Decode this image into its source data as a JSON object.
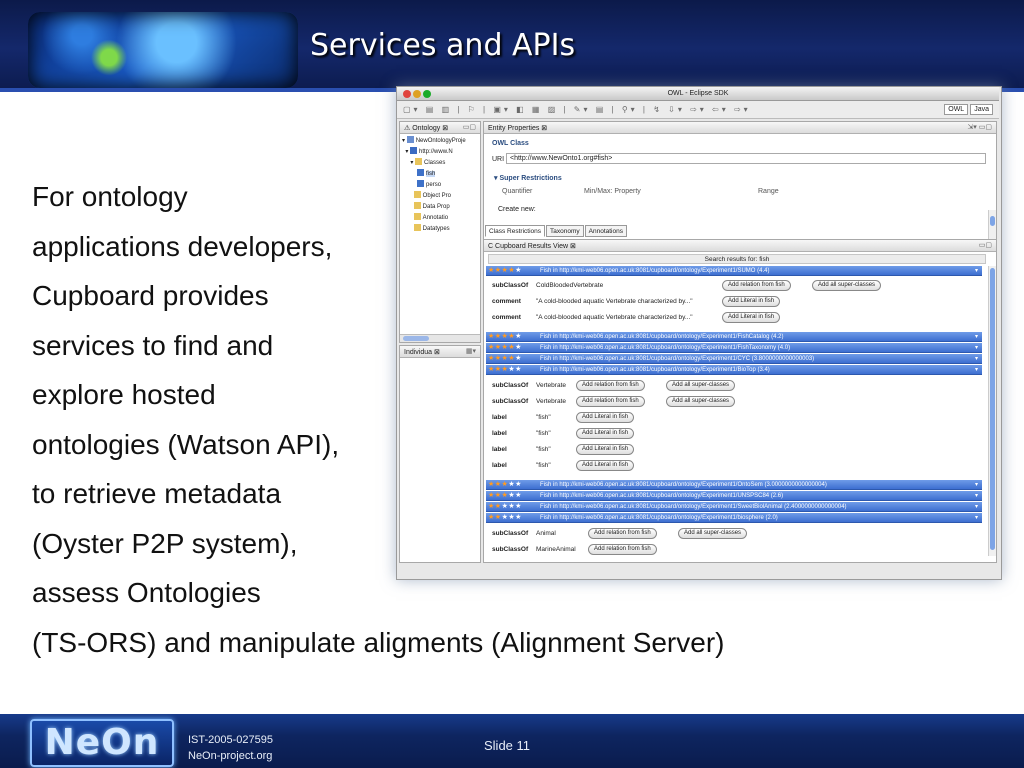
{
  "slide": {
    "title": "Services and APIs",
    "body_lines": [
      "For ontology",
      "applications developers,",
      "Cupboard provides",
      "services to find and",
      "explore hosted",
      "ontologies (Watson API),",
      "to retrieve metadata",
      "(Oyster P2P system),",
      "assess Ontologies",
      "(TS-ORS) and manipulate aligments (Alignment Server)"
    ],
    "footer": {
      "logo": "NeOn",
      "project_id": "IST-2005-027595",
      "site": "NeOn-project.org",
      "slide_number": "Slide 11"
    }
  },
  "eclipse": {
    "window_title": "OWL - Eclipse SDK",
    "perspective": {
      "owl": "OWL",
      "java": "Java"
    },
    "ontology_view": {
      "tab": "Ontology",
      "tree": [
        "NewOntologyProje",
        "http://www.N",
        "Classes",
        "fish",
        "perso",
        "Object Pro",
        "Data Prop",
        "Annotatio",
        "Datatypes"
      ]
    },
    "individuals_view": {
      "tab": "Individua"
    },
    "entity_properties": {
      "tab": "Entity Properties",
      "heading": "OWL Class",
      "uri_label": "URI",
      "uri_value": "<http://www.NewOnto1.org#fish>",
      "super_restrictions": "Super Restrictions",
      "col_quantifier": "Quantifier",
      "col_minmax": "Min/Max: Property",
      "col_range": "Range",
      "create_new": "Create new:",
      "tabs": [
        "Class Restrictions",
        "Taxonomy",
        "Annotations"
      ]
    },
    "cupboard": {
      "tab": "Cupboard Results View",
      "search_text": "Search results for: fish",
      "results": [
        {
          "stars": 4,
          "text": "Fish in http://kmi-web06.open.ac.uk:8081/cupboard/ontology/Experiment1/SUMO (4.4)"
        },
        {
          "stars": 4,
          "text": "Fish in http://kmi-web06.open.ac.uk:8081/cupboard/ontology/Experiment1/FishCatalog (4.2)"
        },
        {
          "stars": 4,
          "text": "Fish in http://kmi-web06.open.ac.uk:8081/cupboard/ontology/Experiment1/FishTaxonomy (4.0)"
        },
        {
          "stars": 4,
          "text": "Fish in http://kmi-web06.open.ac.uk:8081/cupboard/ontology/Experiment1/CYC (3.8000000000000003)"
        },
        {
          "stars": 3,
          "text": "Fish in http://kmi-web06.open.ac.uk:8081/cupboard/ontology/Experiment1/BioTop (3.4)"
        },
        {
          "stars": 3,
          "text": "Fish in http://kmi-web06.open.ac.uk:8081/cupboard/ontology/Experiment1/OntoSem (3.0000000000000004)"
        },
        {
          "stars": 3,
          "text": "Fish in http://kmi-web06.open.ac.uk:8081/cupboard/ontology/Experiment1/UNSPSC84 (2.6)"
        },
        {
          "stars": 2,
          "text": "Fish in http://kmi-web06.open.ac.uk:8081/cupboard/ontology/Experiment1/SweetBiolAnimal (2.4000000000000004)"
        },
        {
          "stars": 2,
          "text": "Fish in http://kmi-web06.open.ac.uk:8081/cupboard/ontology/Experiment1/biosphere (2.0)"
        }
      ],
      "details_sumo": [
        {
          "key": "subClassOf",
          "value": "ColdBloodedVertebrate",
          "buttons": [
            "Add relation from fish",
            "Add all super-classes"
          ]
        },
        {
          "key": "comment",
          "value": "\"A cold-blooded aquatic Vertebrate characterized by...\"",
          "buttons": [
            "Add Literal in fish"
          ]
        },
        {
          "key": "comment",
          "value": "\"A cold-blooded aquatic Vertebrate characterized by...\"",
          "buttons": [
            "Add Literal in fish"
          ]
        }
      ],
      "details_biotop": [
        {
          "key": "subClassOf",
          "value": "Vertebrate",
          "buttons": [
            "Add relation from fish",
            "Add all super-classes"
          ]
        },
        {
          "key": "subClassOf",
          "value": "Vertebrate",
          "buttons": [
            "Add relation from fish",
            "Add all super-classes"
          ]
        },
        {
          "key": "label",
          "value": "\"fish\"",
          "buttons": [
            "Add Literal in fish"
          ]
        },
        {
          "key": "label",
          "value": "\"fish\"",
          "buttons": [
            "Add Literal in fish"
          ]
        },
        {
          "key": "label",
          "value": "\"fish\"",
          "buttons": [
            "Add Literal in fish"
          ]
        },
        {
          "key": "label",
          "value": "\"fish\"",
          "buttons": [
            "Add Literal in fish"
          ]
        }
      ],
      "details_biosphere": [
        {
          "key": "subClassOf",
          "value": "Animal",
          "buttons": [
            "Add relation from fish",
            "Add all super-classes"
          ]
        },
        {
          "key": "subClassOf",
          "value": "MarineAnimal",
          "buttons": [
            "Add relation from fish"
          ]
        }
      ]
    }
  },
  "colors": {
    "header": "#14286b",
    "result_row": "#4a7bd8",
    "star_on": "#ff9a22"
  }
}
